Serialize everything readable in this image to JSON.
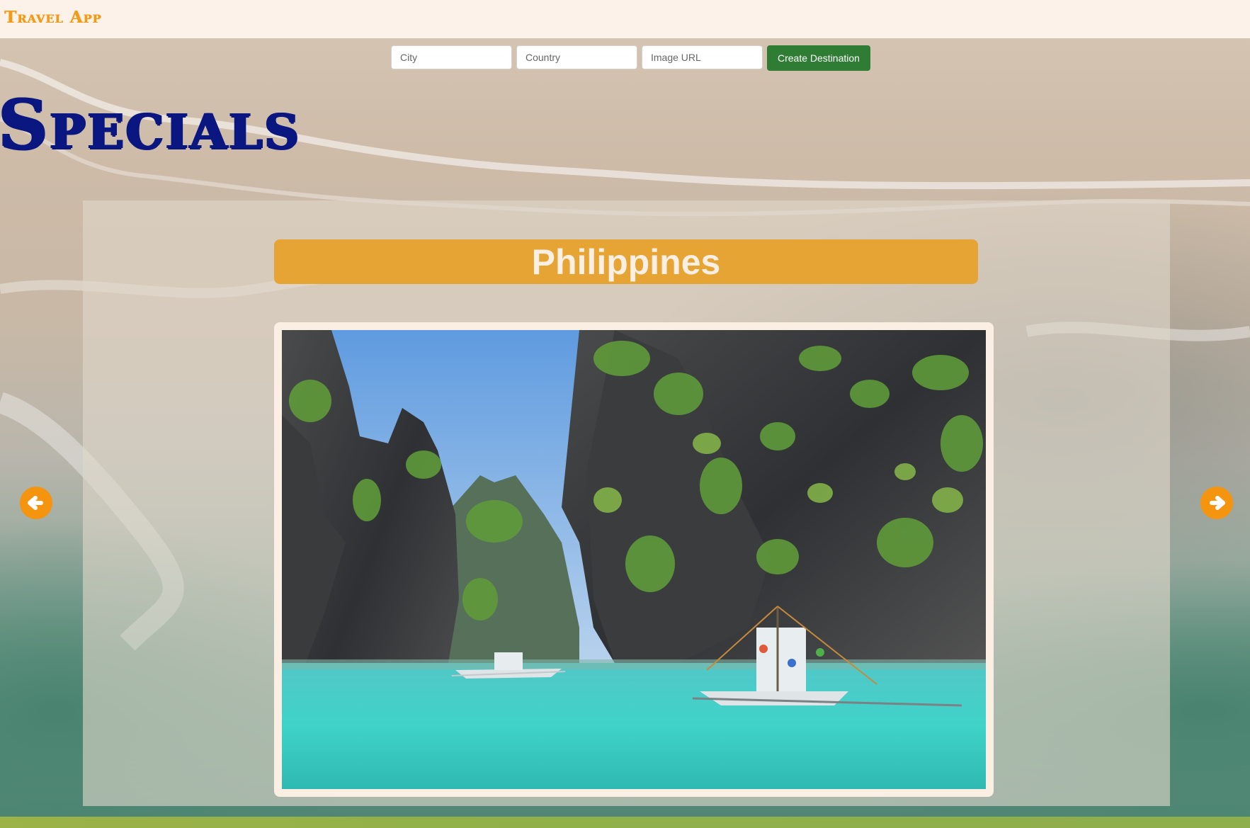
{
  "app": {
    "brand": "Travel App"
  },
  "form": {
    "city_placeholder": "City",
    "country_placeholder": "Country",
    "image_url_placeholder": "Image URL",
    "create_label": "Create Destination"
  },
  "specials": {
    "title": "Specials"
  },
  "carousel": {
    "current_destination": "Philippines",
    "prev_icon": "arrow-left-circle-icon",
    "next_icon": "arrow-right-circle-icon"
  },
  "colors": {
    "brand": "#f39a17",
    "title_navy": "#0a1780",
    "banner_orange": "#e6a434",
    "create_green": "#2f7d34",
    "arrow_orange": "#f5950f",
    "header_bg": "#fdf2ea"
  }
}
